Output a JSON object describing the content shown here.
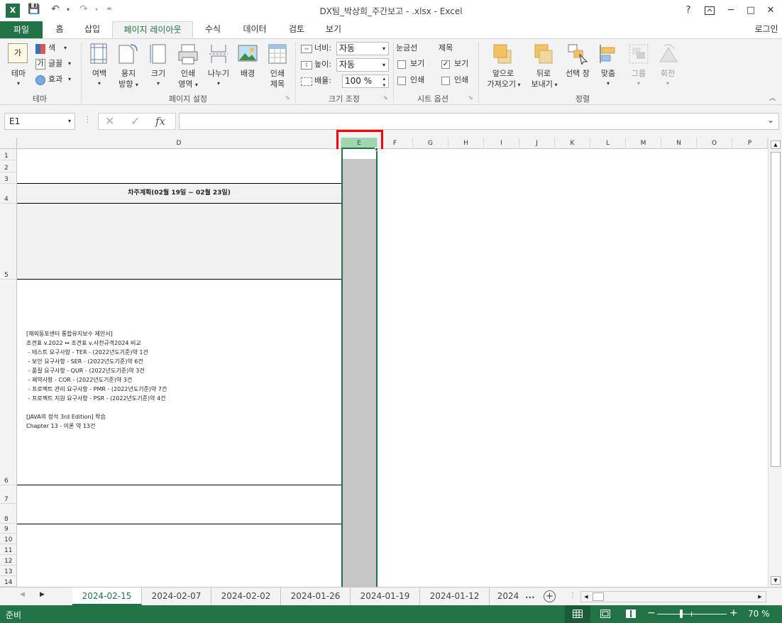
{
  "window": {
    "title": "DX팀_박상희_주간보고 - .xlsx - Excel",
    "login": "로그인",
    "help": "?",
    "restore": "🗗",
    "minimize": "─",
    "maximize": "□",
    "close": "✕"
  },
  "tabs": [
    "파일",
    "홈",
    "삽입",
    "페이지 레이아웃",
    "수식",
    "데이터",
    "검토",
    "보기"
  ],
  "ribbon": {
    "theme": {
      "label": "테마",
      "colors": "색",
      "fonts": "글꼴",
      "effects": "효과",
      "group": "테마"
    },
    "page_setup": {
      "margins": "여백",
      "orientation1": "용지",
      "orientation2": "방향",
      "size": "크기",
      "print_area1": "인쇄",
      "print_area2": "영역",
      "breaks": "나누기",
      "background": "배경",
      "print_titles1": "인쇄",
      "print_titles2": "제목",
      "group": "페이지 설정"
    },
    "scale": {
      "width_label": "너비:",
      "width_value": "자동",
      "height_label": "높이:",
      "height_value": "자동",
      "scale_label": "배율:",
      "scale_value": "100 %",
      "group": "크기 조정"
    },
    "sheet_options": {
      "gridlines": "눈금선",
      "headings": "제목",
      "view": "보기",
      "print": "인쇄",
      "group": "시트 옵션"
    },
    "arrange": {
      "bring_forward1": "앞으로",
      "bring_forward2": "가져오기",
      "send_backward1": "뒤로",
      "send_backward2": "보내기",
      "selection_pane": "선택 창",
      "align": "맞춤",
      "group_obj": "그룹",
      "rotate": "회전",
      "group": "정렬"
    }
  },
  "formula_bar": {
    "name_box": "E1",
    "fx": "fx",
    "value": ""
  },
  "columns": [
    "D",
    "E",
    "F",
    "G",
    "H",
    "I",
    "J",
    "K",
    "L",
    "M",
    "N",
    "O",
    "P"
  ],
  "rows": [
    "1",
    "2",
    "3",
    "4",
    "5",
    "6",
    "7",
    "8",
    "9",
    "10",
    "11",
    "12",
    "13",
    "14"
  ],
  "cells": {
    "d4": "차주계획(02월 19일 ~ 02월 23일)",
    "d6_lines": [
      "[재외동포센터 통합유지보수 제안서]",
      "조견표 v.2022 ↔ 조견표 v.사전규격2024 비교",
      " - 테스트 요구사항 - TER - (2022년도기준)약 1건",
      " - 보안 요구사항 - SER - (2022년도기준)약 6건",
      " - 품질 요구사항 - QUR - (2022년도기준)약 3건",
      " - 제약사항 - COR - (2022년도기준)약 3건",
      " - 프로젝트 관리 요구사항 - PMR - (2022년도기준)약 7건",
      " - 프로젝트 지원 요구사항 - PSR - (2022년도기준)약 4건",
      "",
      "[JAVA의 정석 3rd Edition] 학습",
      "Chapter 13 - 이론 약 13건"
    ]
  },
  "sheets": [
    "2024-02-15",
    "2024-02-07",
    "2024-02-02",
    "2024-01-26",
    "2024-01-19",
    "2024-01-12",
    "2024"
  ],
  "sheet_ellipsis": "...",
  "status": {
    "ready": "준비",
    "zoom": "70 %"
  },
  "colors": {
    "accent": "#217346",
    "highlight": "#ff0000",
    "selected_col": "#a0d5b0"
  }
}
